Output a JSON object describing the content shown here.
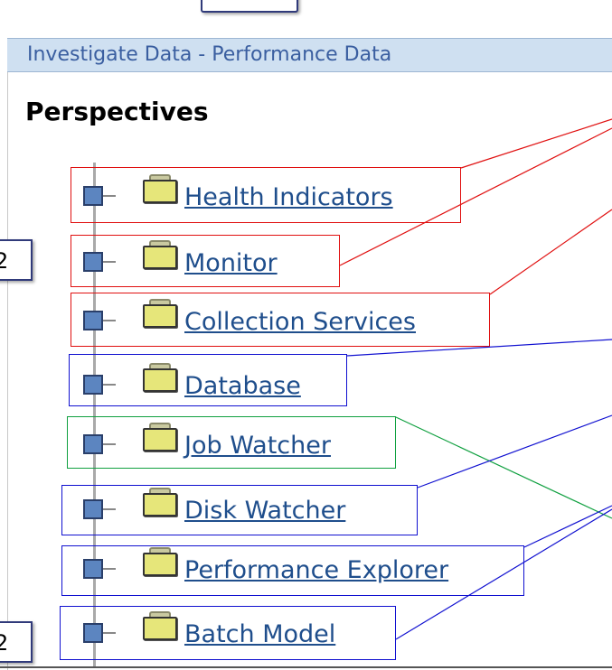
{
  "window": {
    "title": "Investigate Data - Performance Data"
  },
  "panel": {
    "heading": "Perspectives"
  },
  "tree": {
    "items": [
      {
        "label": "Health Indicators",
        "group": "red"
      },
      {
        "label": "Monitor",
        "group": "red"
      },
      {
        "label": "Collection Services",
        "group": "red"
      },
      {
        "label": "Database",
        "group": "blue"
      },
      {
        "label": "Job Watcher",
        "group": "green"
      },
      {
        "label": "Disk Watcher",
        "group": "blue"
      },
      {
        "label": "Performance Explorer",
        "group": "blue"
      },
      {
        "label": "Batch Model",
        "group": "blue"
      }
    ]
  },
  "side_labels": {
    "upper": "2",
    "lower": "2"
  },
  "colors": {
    "title_bar": "#cfe0f1",
    "title_text": "#3a5ea0",
    "link": "#1f4e8c",
    "callout_red": "#e01010",
    "callout_blue": "#1010d0",
    "callout_green": "#10a040",
    "expander": "#5c85c0",
    "folder": "#e6e67a"
  },
  "icons": {
    "expander": "plus-expander-icon",
    "folder": "folder-icon"
  }
}
